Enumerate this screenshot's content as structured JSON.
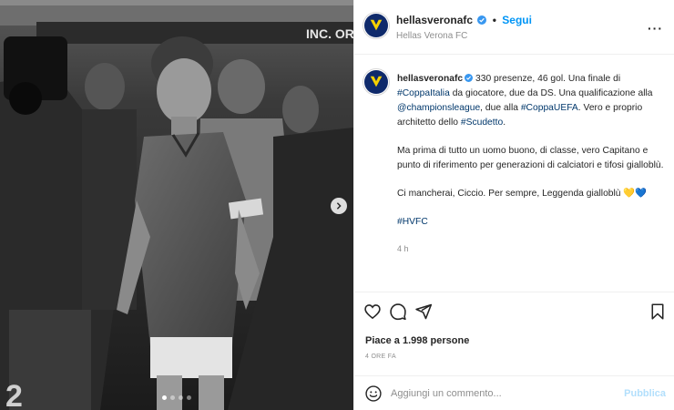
{
  "post": {
    "username": "hellasveronafc",
    "follow_label": "Segui",
    "separator": "•",
    "account_subtitle": "Hellas Verona FC",
    "more_label": "···"
  },
  "media": {
    "photo_sign_text": "INC. OR",
    "carousel_pages": 4,
    "active_page": 1
  },
  "caption": {
    "username": "hellasveronafc",
    "p1_a": " 330 presenze, 46 gol. Una finale di ",
    "p1_tag1": "#CoppaItalia",
    "p1_b": " da giocatore, due da DS. Una qualificazione alla ",
    "p1_tag2": "@championsleague",
    "p1_c": ", due alla ",
    "p1_tag3": "#CoppaUEFA",
    "p1_d": ". Vero e proprio architetto dello ",
    "p1_tag4": "#Scudetto",
    "p1_e": ".",
    "p2": "Ma prima di tutto un uomo buono, di classe, vero Capitano e punto di riferimento per generazioni di calciatori e tifosi gialloblù.",
    "p3": "Ci mancherai, Ciccio. Per sempre, Leggenda gialloblù 💛💙",
    "p4_tag": "#HVFC",
    "time_ago": "4 h"
  },
  "stats": {
    "likes": "Piace a 1.998 persone",
    "date": "4 ORE FA"
  },
  "comment": {
    "placeholder": "Aggiungi un commento...",
    "publish_label": "Pubblica"
  },
  "colors": {
    "accent_link": "#0095f6",
    "hashtag": "#00376b",
    "verified": "#3897f0",
    "club_blue": "#0f2a6b",
    "club_yellow": "#f5d100"
  },
  "icons": [
    "heart-icon",
    "comment-icon",
    "share-icon",
    "bookmark-icon",
    "emoji-icon",
    "verified-icon",
    "chevron-right-icon"
  ]
}
